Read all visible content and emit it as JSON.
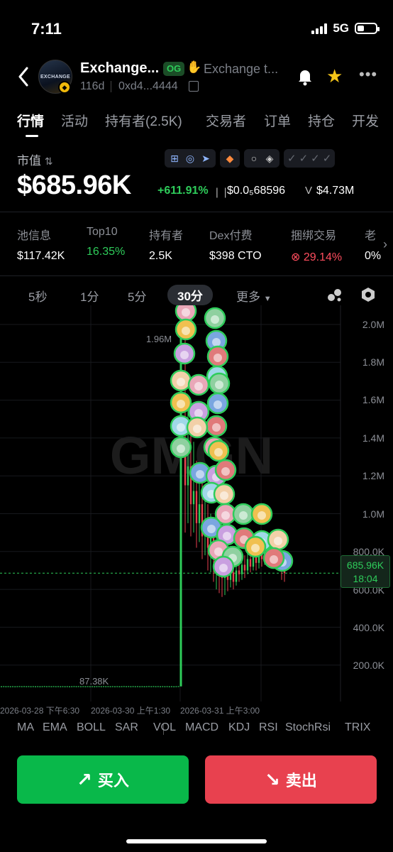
{
  "status_bar": {
    "time": "7:11",
    "network": "5G"
  },
  "header": {
    "token_name": "Exchange...",
    "logo_text": "EXCHANGE",
    "og_badge": "OG",
    "description": "Exchange t...",
    "age": "116d",
    "address": "0xd4...4444"
  },
  "tabs": [
    "行情",
    "活动",
    "持有者(2.5K)",
    "交易者",
    "订单",
    "持仓",
    "开发"
  ],
  "market": {
    "label": "市值",
    "sort_glyph": "⇅",
    "value": "$685.96K",
    "change": "+611.91%",
    "price": "$0.0₅68596",
    "volume_prefix": "V",
    "volume": "$4.73M"
  },
  "stats": [
    {
      "label": "池信息",
      "value": "$117.42K",
      "tone": ""
    },
    {
      "label": "Top10",
      "value": "16.35%",
      "tone": "green"
    },
    {
      "label": "持有者",
      "value": "2.5K",
      "tone": ""
    },
    {
      "label": "Dex付费",
      "value": "$398 CTO",
      "tone": ""
    },
    {
      "label": "捆绑交易",
      "value": "⊗ 29.14%",
      "tone": "red"
    },
    {
      "label": "老",
      "value": "0%",
      "tone": ""
    }
  ],
  "intervals": [
    "5秒",
    "1分",
    "5分",
    "30分",
    "更多"
  ],
  "active_interval": "30分",
  "chart": {
    "watermark": "GMGN",
    "y_axis": [
      "2.0M",
      "1.8M",
      "1.6M",
      "1.4M",
      "1.2M",
      "1.0M",
      "800.0K",
      "600.0K",
      "400.0K",
      "200.0K"
    ],
    "current_price": "685.96K",
    "countdown": "18:04",
    "high_label": "1.96M",
    "low_label": "87.38K",
    "time_axis": [
      "2026-03-28 下午6:30",
      "2026-03-30 上午1:30",
      "2026-03-31 上午3:00"
    ],
    "colors": {
      "up": "#2ecc5a",
      "down": "#e8414f"
    }
  },
  "indicators": [
    "MA",
    "EMA",
    "BOLL",
    "SAR",
    "VOL",
    "MACD",
    "KDJ",
    "RSI",
    "StochRsi",
    "TRIX"
  ],
  "actions": {
    "buy": "买入",
    "sell": "卖出"
  },
  "chart_data": {
    "type": "candlestick",
    "ylim": [
      0,
      2100000
    ],
    "series": [
      {
        "phase": "flat",
        "value": 87380
      },
      {
        "phase": "spike_high",
        "value": 1960000
      },
      {
        "phase": "current",
        "value": 685960
      }
    ]
  }
}
